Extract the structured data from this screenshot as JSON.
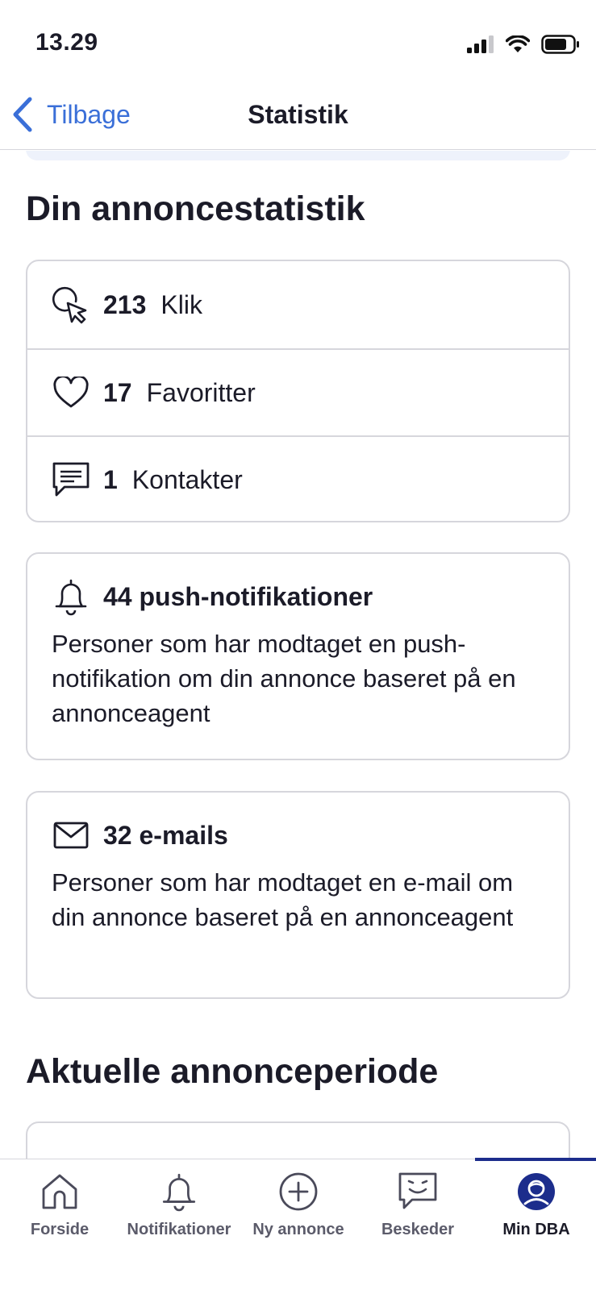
{
  "status_bar": {
    "time": "13.29"
  },
  "nav": {
    "back_label": "Tilbage",
    "title": "Statistik"
  },
  "stats_section": {
    "title": "Din annoncestatistik",
    "rows": [
      {
        "icon": "click-icon",
        "count": "213",
        "label": "Klik"
      },
      {
        "icon": "heart-icon",
        "count": "17",
        "label": "Favoritter"
      },
      {
        "icon": "message-icon",
        "count": "1",
        "label": "Kontakter"
      }
    ]
  },
  "push_card": {
    "icon": "bell-icon",
    "title": "44 push-notifikationer",
    "description": "Personer som har modtaget en push-notifikation om din annonce baseret på en annonceagent"
  },
  "email_card": {
    "icon": "envelope-icon",
    "title": "32 e-mails",
    "description": "Personer som har modtaget en e-mail om din annonce baseret på en annonceagent"
  },
  "period_section": {
    "title": "Aktuelle annonceperiode"
  },
  "tab_bar": {
    "active_color": "#1c2d8c",
    "link_color": "#3a6fd8",
    "tabs": [
      {
        "label": "Forside",
        "icon": "home-icon"
      },
      {
        "label": "Notifikationer",
        "icon": "bell-icon"
      },
      {
        "label": "Ny annonce",
        "icon": "plus-circle-icon"
      },
      {
        "label": "Beskeder",
        "icon": "chat-icon"
      },
      {
        "label": "Min DBA",
        "icon": "profile-icon",
        "active": true
      }
    ]
  }
}
